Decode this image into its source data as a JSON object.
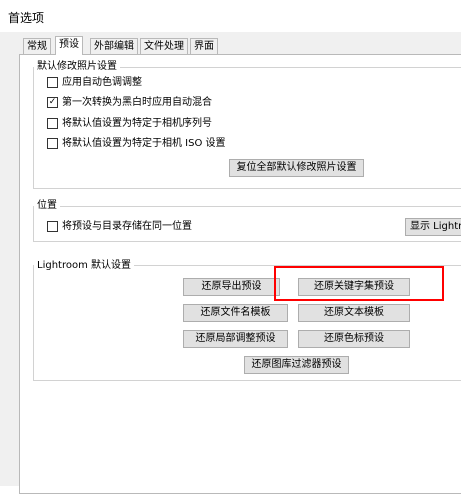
{
  "window": {
    "title": "首选项"
  },
  "tabs": [
    {
      "label": "常规"
    },
    {
      "label": "预设",
      "active": true
    },
    {
      "label": "外部编辑"
    },
    {
      "label": "文件处理"
    },
    {
      "label": "界面"
    }
  ],
  "default_develop": {
    "heading": "默认修改照片设置",
    "options": [
      {
        "label": "应用自动色调调整",
        "checked": false
      },
      {
        "label": "第一次转换为黑白时应用自动混合",
        "checked": true
      },
      {
        "label": "将默认值设置为特定于相机序列号",
        "checked": false
      },
      {
        "label": "将默认值设置为特定于相机 ISO 设置",
        "checked": false
      }
    ],
    "reset_button": "复位全部默认修改照片设置"
  },
  "location": {
    "heading": "位置",
    "store_option": {
      "label": "将预设与目录存储在同一位置",
      "checked": false
    },
    "show_button": "显示 Lightroom"
  },
  "lightroom_defaults": {
    "heading": "Lightroom 默认设置",
    "buttons": {
      "restore_export": "还原导出预设",
      "restore_keyword": "还原关键字集预设",
      "restore_filename": "还原文件名模板",
      "restore_text": "还原文本模板",
      "restore_local": "还原局部调整预设",
      "restore_color": "还原色标预设",
      "restore_library_filter": "还原图库过滤器预设"
    }
  },
  "colors": {
    "highlight": "#ff0000"
  }
}
